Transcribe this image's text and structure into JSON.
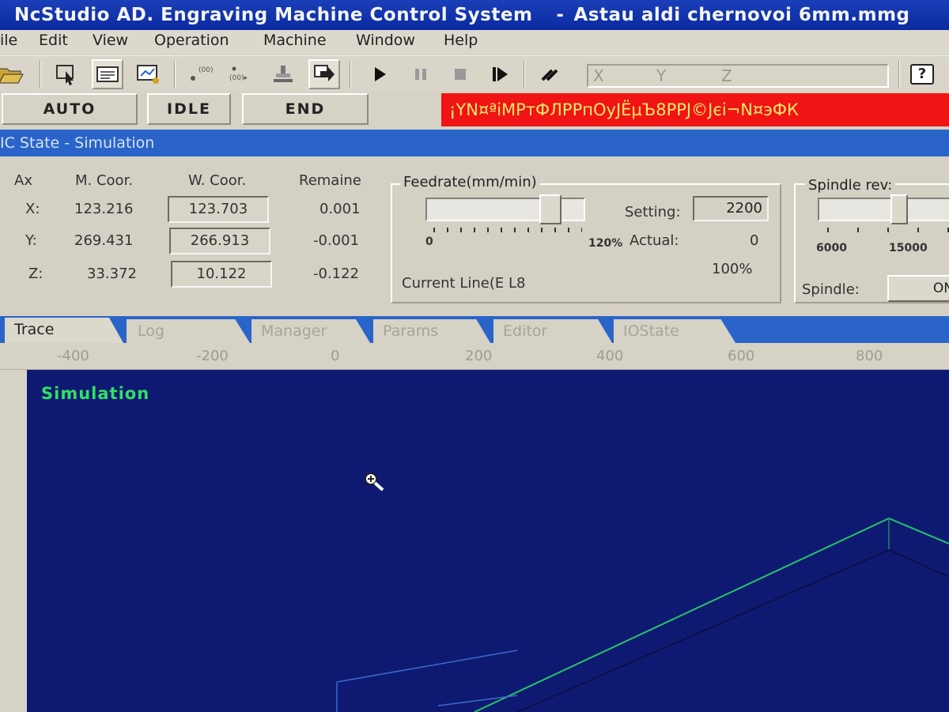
{
  "window": {
    "title": "NcStudio AD. Engraving Machine Control System",
    "separator": "-",
    "file": "Astau aldi chernovoi 6mm.mmg"
  },
  "menu": [
    "ile",
    "Edit",
    "View",
    "Operation",
    "Machine",
    "Window",
    "Help"
  ],
  "toolbar": {
    "coord_labels": [
      "X",
      "Y",
      "Z"
    ],
    "help_label": "?"
  },
  "status": {
    "mode": "AUTO",
    "state": "IDLE",
    "program": "END",
    "message": "¡YN¤ªiMPтФЛРРпОуJЁµЪ8РРJ©Jєi¬N¤эФК",
    "message_color": "#f01414"
  },
  "panel": {
    "title": "IC State - Simulation",
    "headers": {
      "axis": "Ax",
      "mcoor": "M. Coor.",
      "wcoor": "W. Coor.",
      "remain": "Remaine"
    },
    "axes": [
      {
        "label": "X:",
        "m": "123.216",
        "w": "123.703",
        "remain": "0.001"
      },
      {
        "label": "Y:",
        "m": "269.431",
        "w": "266.913",
        "remain": "-0.001"
      },
      {
        "label": "Z:",
        "m": "33.372",
        "w": "10.122",
        "remain": "-0.122"
      }
    ],
    "feedrate": {
      "title": "Feedrate(mm/min)",
      "min_label": "0",
      "max_label": "120%",
      "setting_label": "Setting:",
      "setting_value": "2200",
      "actual_label": "Actual:",
      "actual_value": "0",
      "percent": "100%",
      "current_line": "Current Line(E L8",
      "slider_fraction": 0.83
    },
    "spindle": {
      "title": "Spindle rev:",
      "min_label": "6000",
      "mid_label": "15000",
      "spindle_label": "Spindle:",
      "button": "ON",
      "slider_fraction": 0.55
    }
  },
  "tabs": [
    "Trace",
    "Log",
    "Manager",
    "Params",
    "Editor",
    "IOState"
  ],
  "ruler": [
    "-400",
    "-200",
    "0",
    "200",
    "400",
    "600",
    "800"
  ],
  "simulation": {
    "label": "Simulation",
    "background": "#0e1a72",
    "line_color": "#29c06a"
  }
}
